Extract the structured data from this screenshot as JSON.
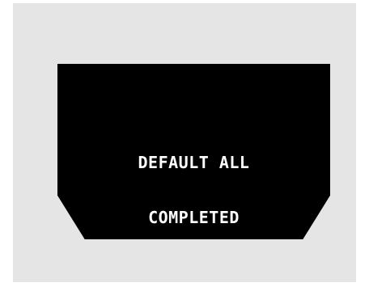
{
  "display": {
    "line1": "DEFAULT ALL",
    "line2": "COMPLETED"
  },
  "colors": {
    "background": "#e5e5e5",
    "screen": "#000000",
    "text": "#ffffff"
  }
}
